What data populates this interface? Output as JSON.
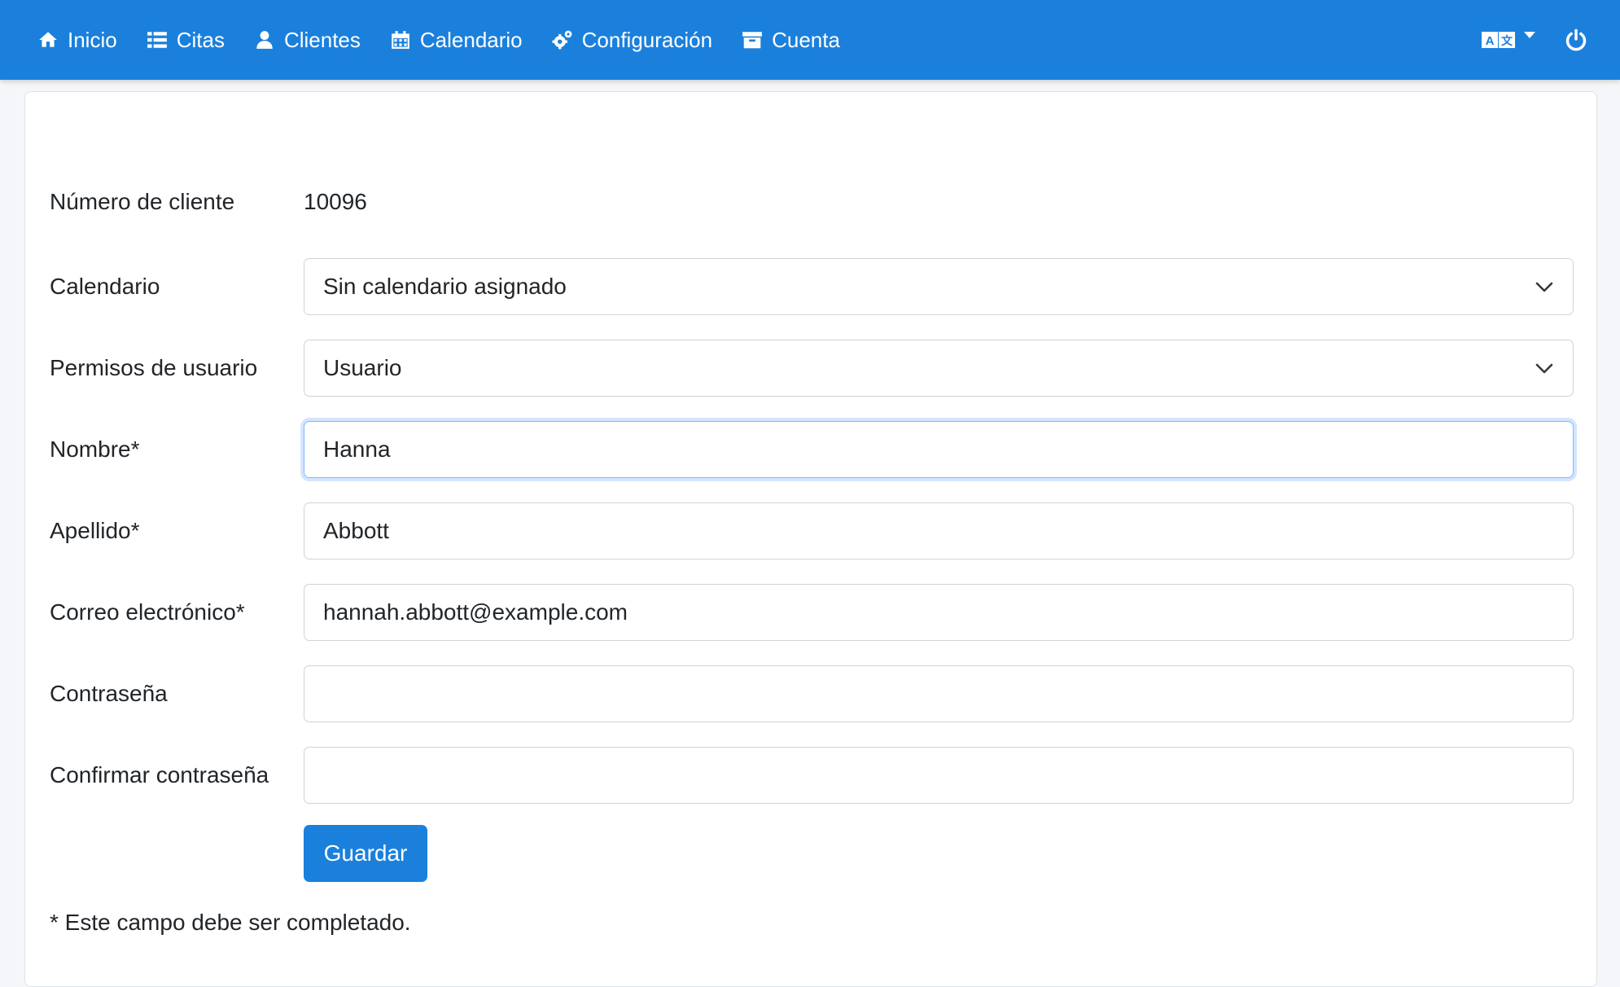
{
  "nav": {
    "items": [
      {
        "label": "Inicio",
        "icon": "home-icon"
      },
      {
        "label": "Citas",
        "icon": "list-icon"
      },
      {
        "label": "Clientes",
        "icon": "user-icon"
      },
      {
        "label": "Calendario",
        "icon": "calendar-icon"
      },
      {
        "label": "Configuración",
        "icon": "cogs-icon"
      },
      {
        "label": "Cuenta",
        "icon": "archive-icon"
      }
    ],
    "right_icons": [
      "language-icon",
      "power-icon"
    ]
  },
  "form": {
    "client_number_label": "Número de cliente",
    "client_number_value": "10096",
    "calendar_label": "Calendario",
    "calendar_value": "Sin calendario asignado",
    "permissions_label": "Permisos de usuario",
    "permissions_value": "Usuario",
    "first_name_label": "Nombre*",
    "first_name_value": "Hanna",
    "last_name_label": "Apellido*",
    "last_name_value": "Abbott",
    "email_label": "Correo electrónico*",
    "email_value": "hannah.abbott@example.com",
    "password_label": "Contraseña",
    "password_value": "",
    "confirm_password_label": "Confirmar contraseña",
    "confirm_password_value": "",
    "save_button": "Guardar",
    "required_note": "* Este campo debe ser completado."
  },
  "colors": {
    "primary": "#1b80dc",
    "focus_ring": "#86b7fe"
  }
}
